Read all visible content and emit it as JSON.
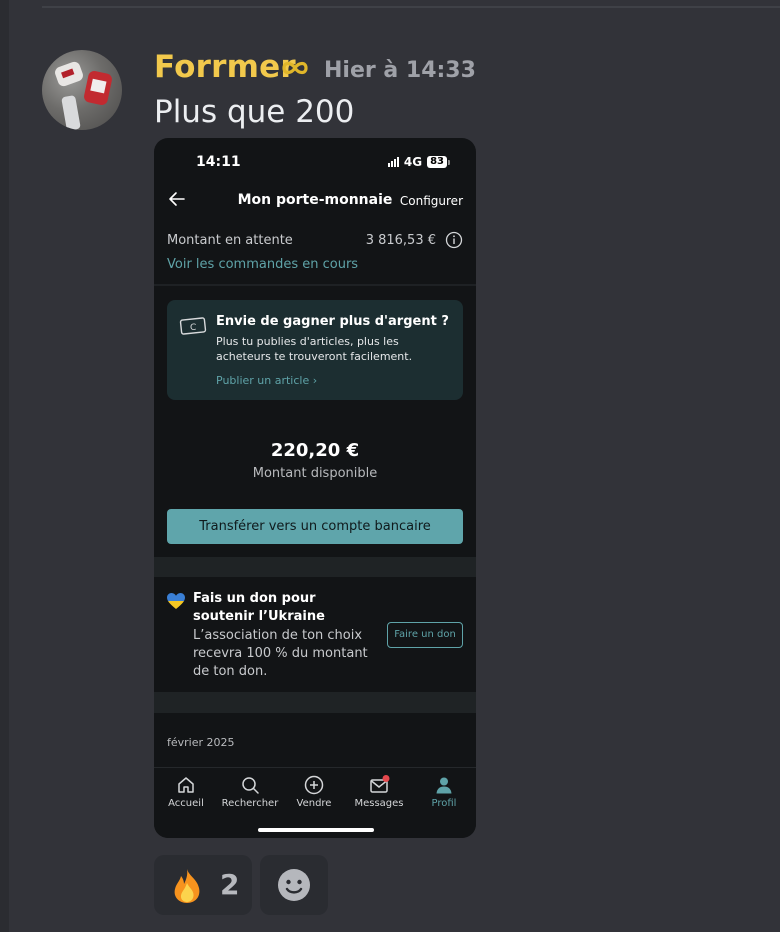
{
  "message": {
    "author": "Forrmer",
    "author_color": "#f2c94c",
    "badge_icon": "infinity-icon",
    "timestamp": "Hier à 14:33",
    "text": "Plus que 200"
  },
  "phone": {
    "status_time": "14:11",
    "network": "4G",
    "battery": "83",
    "nav_title": "Mon porte-monnaie",
    "nav_action": "Configurer",
    "pending_label": "Montant en attente",
    "pending_amount": "3 816,53 €",
    "orders_link": "Voir les commandes en cours",
    "promo": {
      "title": "Envie de gagner plus d'argent ?",
      "body": "Plus tu publies d'articles, plus les acheteurs te trouveront facilement.",
      "link": "Publier un article"
    },
    "balance": "220,20 €",
    "balance_label": "Montant disponible",
    "transfer_button": "Transférer vers un compte bancaire",
    "donate": {
      "title": "Fais un don pour soutenir l’Ukraine",
      "body": "L’association de ton choix recevra 100 % du montant de ton don.",
      "button": "Faire un don"
    },
    "month": "février 2025",
    "tabs": [
      {
        "label": "Accueil",
        "icon": "home-icon"
      },
      {
        "label": "Rechercher",
        "icon": "search-icon"
      },
      {
        "label": "Vendre",
        "icon": "plus-circle-icon"
      },
      {
        "label": "Messages",
        "icon": "mail-icon"
      },
      {
        "label": "Profil",
        "icon": "profile-icon",
        "active": true
      }
    ],
    "accent_color": "#5fa5ab"
  },
  "reactions": [
    {
      "emoji": "fire-icon",
      "count": "2"
    },
    {
      "emoji": "add-reaction-icon"
    }
  ]
}
